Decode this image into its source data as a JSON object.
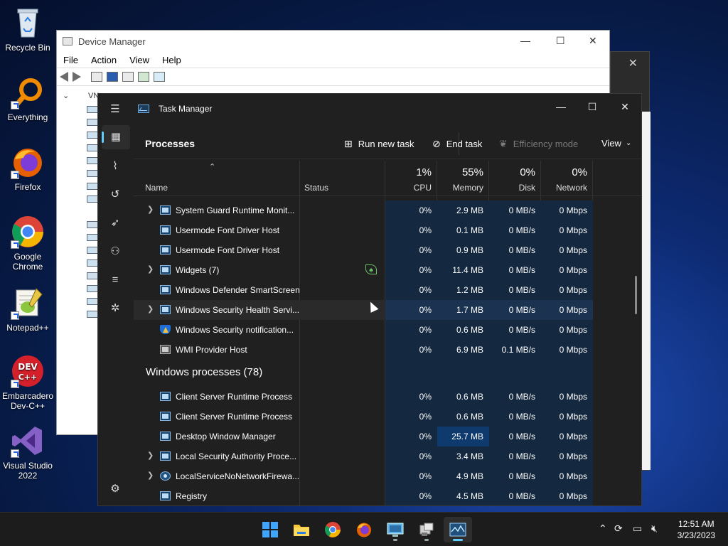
{
  "desktop": {
    "icons": [
      {
        "label": "Recycle Bin"
      },
      {
        "label": "Everything"
      },
      {
        "label": "Firefox"
      },
      {
        "label": "Google Chrome"
      },
      {
        "label": "Notepad++"
      },
      {
        "label": "Embarcadero Dev-C++"
      },
      {
        "label": "Visual Studio 2022"
      }
    ]
  },
  "device_manager": {
    "title": "Device Manager",
    "menu": [
      "File",
      "Action",
      "View",
      "Help"
    ],
    "tree_root": "VN"
  },
  "task_manager": {
    "title": "Task Manager",
    "section": "Processes",
    "commands": {
      "run_new_task": "Run new task",
      "end_task": "End task",
      "efficiency_mode": "Efficiency mode",
      "view": "View"
    },
    "columns": {
      "name": "Name",
      "status": "Status",
      "cpu_pct": "1%",
      "cpu": "CPU",
      "mem_pct": "55%",
      "mem": "Memory",
      "disk_pct": "0%",
      "disk": "Disk",
      "net_pct": "0%",
      "net": "Network"
    },
    "rows": [
      {
        "name": "System Guard Runtime Monit...",
        "cpu": "0%",
        "mem": "2.9 MB",
        "disk": "0 MB/s",
        "net": "0 Mbps"
      },
      {
        "name": "Usermode Font Driver Host",
        "cpu": "0%",
        "mem": "0.1 MB",
        "disk": "0 MB/s",
        "net": "0 Mbps"
      },
      {
        "name": "Usermode Font Driver Host",
        "cpu": "0%",
        "mem": "0.9 MB",
        "disk": "0 MB/s",
        "net": "0 Mbps"
      },
      {
        "name": "Widgets (7)",
        "cpu": "0%",
        "mem": "11.4 MB",
        "disk": "0 MB/s",
        "net": "0 Mbps"
      },
      {
        "name": "Windows Defender SmartScreen",
        "cpu": "0%",
        "mem": "1.2 MB",
        "disk": "0 MB/s",
        "net": "0 Mbps"
      },
      {
        "name": "Windows Security Health Servi...",
        "cpu": "0%",
        "mem": "1.7 MB",
        "disk": "0 MB/s",
        "net": "0 Mbps"
      },
      {
        "name": "Windows Security notification...",
        "cpu": "0%",
        "mem": "0.6 MB",
        "disk": "0 MB/s",
        "net": "0 Mbps"
      },
      {
        "name": "WMI Provider Host",
        "cpu": "0%",
        "mem": "6.9 MB",
        "disk": "0.1 MB/s",
        "net": "0 Mbps"
      }
    ],
    "group_title": "Windows processes (78)",
    "rows2": [
      {
        "name": "Client Server Runtime Process",
        "cpu": "0%",
        "mem": "0.6 MB",
        "disk": "0 MB/s",
        "net": "0 Mbps"
      },
      {
        "name": "Client Server Runtime Process",
        "cpu": "0%",
        "mem": "0.6 MB",
        "disk": "0 MB/s",
        "net": "0 Mbps"
      },
      {
        "name": "Desktop Window Manager",
        "cpu": "0%",
        "mem": "25.7 MB",
        "disk": "0 MB/s",
        "net": "0 Mbps"
      },
      {
        "name": "Local Security Authority Proce...",
        "cpu": "0%",
        "mem": "3.4 MB",
        "disk": "0 MB/s",
        "net": "0 Mbps"
      },
      {
        "name": "LocalServiceNoNetworkFirewa...",
        "cpu": "0%",
        "mem": "4.9 MB",
        "disk": "0 MB/s",
        "net": "0 Mbps"
      },
      {
        "name": "Registry",
        "cpu": "0%",
        "mem": "4.5 MB",
        "disk": "0 MB/s",
        "net": "0 Mbps"
      }
    ]
  },
  "taskbar": {
    "time": "12:51 AM",
    "date": "3/23/2023"
  },
  "colors": {
    "accent": "#60cdff",
    "tm_bg": "#202020",
    "heat": "#14283f"
  }
}
